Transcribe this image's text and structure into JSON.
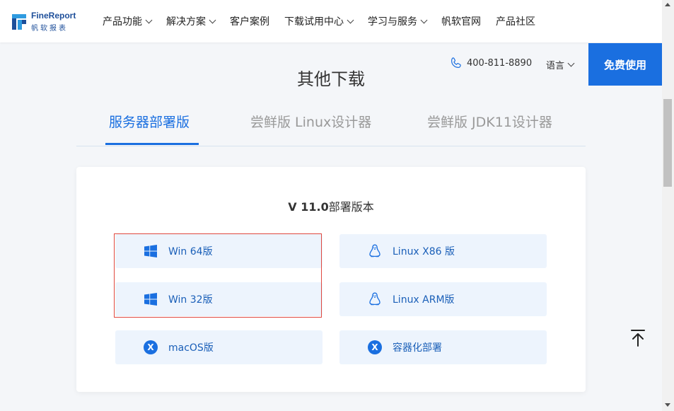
{
  "brand": {
    "name_en": "FineReport",
    "name_cn": "帆软报表"
  },
  "nav": {
    "items": [
      {
        "label": "产品功能",
        "dropdown": true
      },
      {
        "label": "解决方案",
        "dropdown": true
      },
      {
        "label": "客户案例",
        "dropdown": false
      },
      {
        "label": "下载试用中心",
        "dropdown": true
      },
      {
        "label": "学习与服务",
        "dropdown": true
      },
      {
        "label": "帆软官网",
        "dropdown": false
      },
      {
        "label": "产品社区",
        "dropdown": false
      }
    ]
  },
  "contact": {
    "phone": "400-811-8890",
    "icon": "phone-icon"
  },
  "language": {
    "label": "语言"
  },
  "cta": {
    "label": "免费使用"
  },
  "page": {
    "title": "其他下载"
  },
  "tabs": [
    {
      "label": "服务器部署版",
      "active": true
    },
    {
      "label": "尝鲜版 Linux设计器",
      "active": false
    },
    {
      "label": "尝鲜版 JDK11设计器",
      "active": false
    }
  ],
  "card": {
    "version_bold": "V 11.0",
    "version_rest": "部署版本",
    "downloads": [
      {
        "label": "Win 64版",
        "icon": "windows-icon"
      },
      {
        "label": "Linux X86 版",
        "icon": "linux-penguin-icon"
      },
      {
        "label": "Win 32版",
        "icon": "windows-icon"
      },
      {
        "label": "Linux ARM版",
        "icon": "linux-penguin-icon"
      },
      {
        "label": "macOS版",
        "icon": "x-circle-icon",
        "glyph": "X"
      },
      {
        "label": "容器化部署",
        "icon": "x-circle-icon",
        "glyph": "X"
      }
    ]
  },
  "colors": {
    "accent": "#1a6fe0",
    "highlight": "#e0483f",
    "button_bg": "#edf4fd",
    "page_bg": "#f4f6f9"
  }
}
